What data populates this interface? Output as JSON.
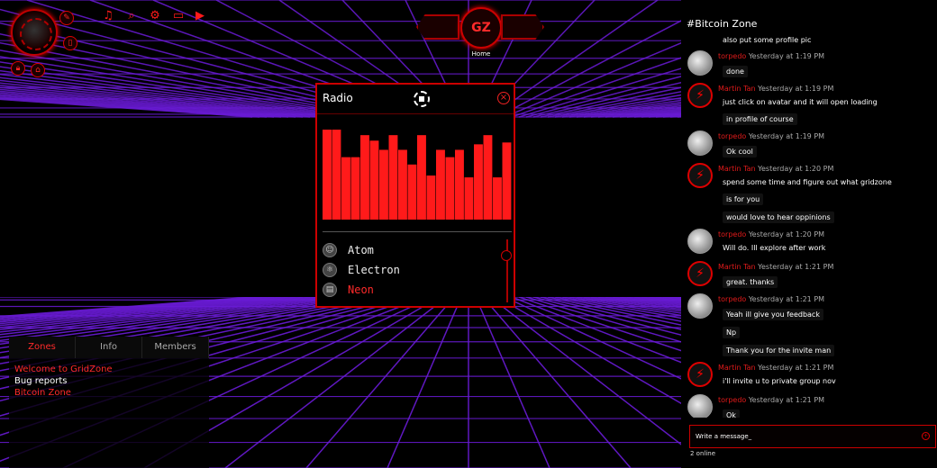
{
  "app": {
    "hub_label": "Home",
    "hub_logo": "GZ"
  },
  "toolbar": [
    "music-icon",
    "search-icon",
    "settings-icon",
    "chat-icon",
    "play-icon"
  ],
  "radio": {
    "title": "Radio",
    "eq_levels": [
      0.98,
      0.98,
      0.68,
      0.68,
      0.92,
      0.86,
      0.76,
      0.92,
      0.76,
      0.6,
      0.92,
      0.48,
      0.76,
      0.68,
      0.76,
      0.46,
      0.82,
      0.92,
      0.46,
      0.84
    ],
    "stations": [
      {
        "label": "Atom",
        "icon": "alien-icon",
        "active": false
      },
      {
        "label": "Electron",
        "icon": "atom-icon",
        "active": false
      },
      {
        "label": "Neon",
        "icon": "keyboard-icon",
        "active": true
      }
    ]
  },
  "zones": {
    "tabs": [
      "Zones",
      "Info",
      "Members"
    ],
    "active_tab": 0,
    "items": [
      {
        "label": "Welcome to GridZone",
        "color": "#ff2a2a"
      },
      {
        "label": "Bug reports",
        "color": "#ffffff"
      },
      {
        "label": "Bitcoin Zone",
        "color": "#ff2a2a"
      }
    ]
  },
  "chat": {
    "title": "#Bitcoin Zone",
    "composer_placeholder": "Write a message_",
    "online": "2 online",
    "first_line": "also put some profile pic",
    "messages": [
      {
        "user": "torpedo",
        "time": "Yesterday at 1:19 PM",
        "lines": [
          "done"
        ]
      },
      {
        "user": "Martin Tan",
        "time": "Yesterday at 1:19 PM",
        "lines": [
          "just click on avatar and it will open loading",
          "in profile of course"
        ]
      },
      {
        "user": "torpedo",
        "time": "Yesterday at 1:19 PM",
        "lines": [
          "Ok cool"
        ]
      },
      {
        "user": "Martin Tan",
        "time": "Yesterday at 1:20 PM",
        "lines": [
          "spend some time and figure out what gridzone",
          "is for you",
          "would love to hear oppinions"
        ]
      },
      {
        "user": "torpedo",
        "time": "Yesterday at 1:20 PM",
        "lines": [
          "Will do. Ill explore after work"
        ]
      },
      {
        "user": "Martin Tan",
        "time": "Yesterday at 1:21 PM",
        "lines": [
          "great. thanks"
        ]
      },
      {
        "user": "torpedo",
        "time": "Yesterday at 1:21 PM",
        "lines": [
          "Yeah ill give you feedback",
          "Np",
          "Thank you for the invite man"
        ]
      },
      {
        "user": "Martin Tan",
        "time": "Yesterday at 1:21 PM",
        "lines": [
          "i'll invite u to private group nov"
        ]
      },
      {
        "user": "torpedo",
        "time": "Yesterday at 1:21 PM",
        "lines": [
          "Ok"
        ]
      }
    ]
  },
  "colors": {
    "accent": "#ff1a1a",
    "grid": "#6a1bd6",
    "panel_border": "#cc0000"
  }
}
